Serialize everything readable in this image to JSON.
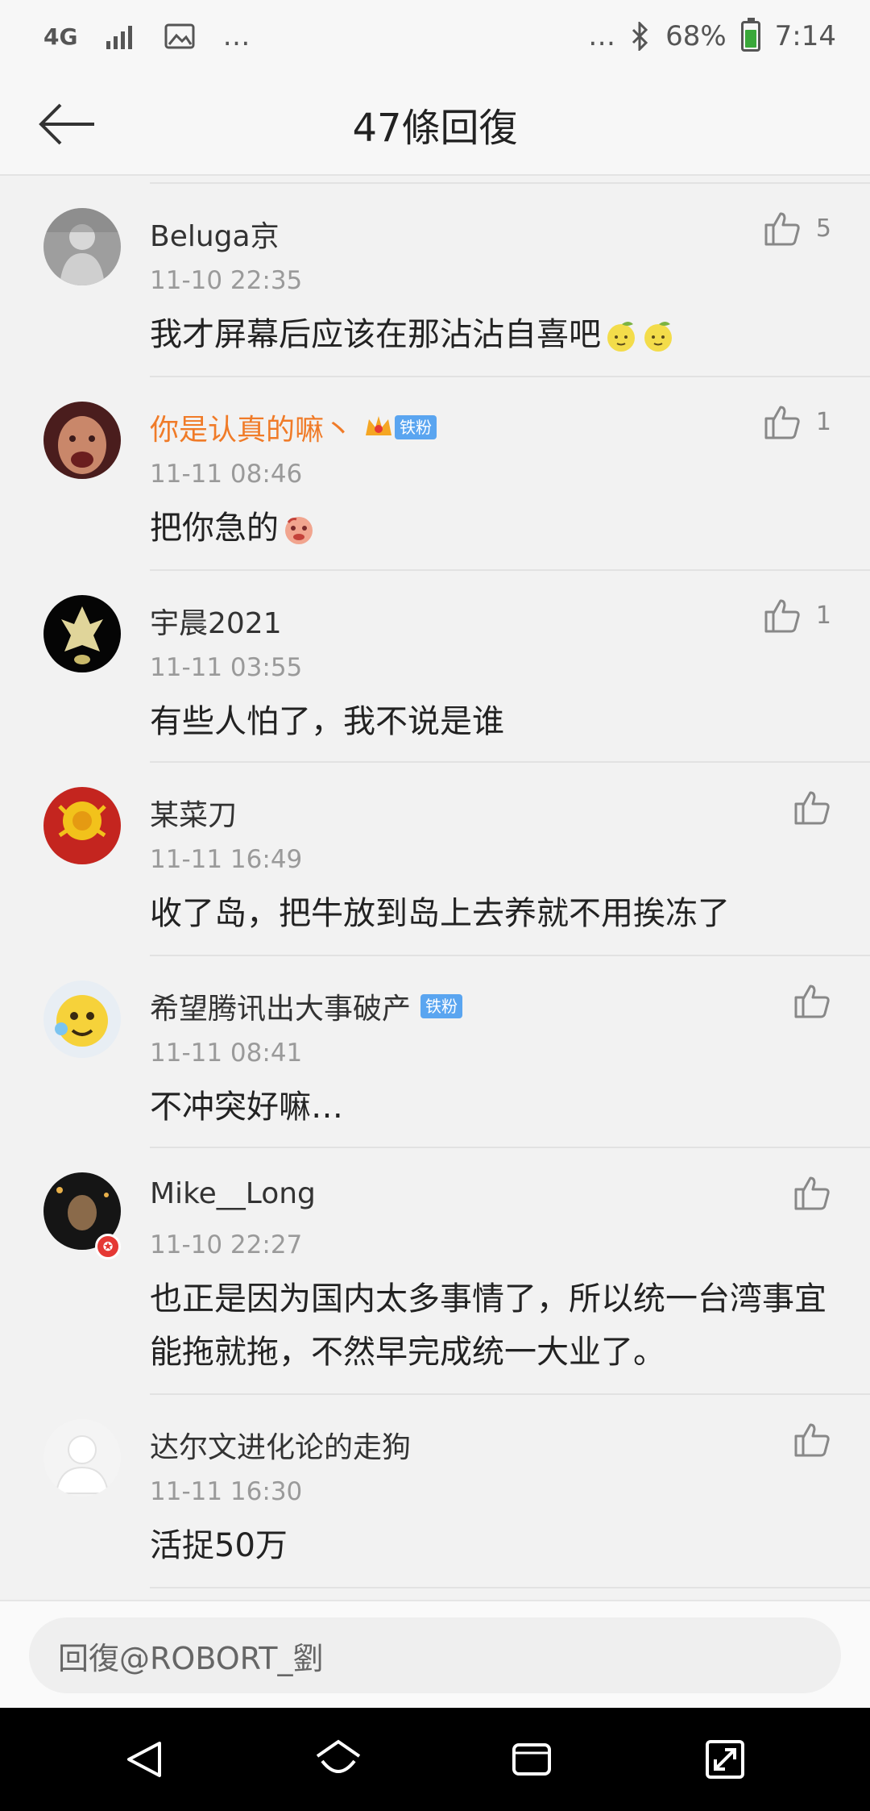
{
  "status_bar": {
    "network": "4G",
    "left_more": "…",
    "right_more": "…",
    "battery": "68%",
    "time": "7:14",
    "icons": [
      "signal-icon",
      "image-icon",
      "bluetooth-icon",
      "battery-icon"
    ]
  },
  "header": {
    "title": "47條回復",
    "back_icon": "arrow-left-icon"
  },
  "comments": [
    {
      "user": "Beluga京",
      "time": "11-10 22:35",
      "text": "我才屏幕后应该在那沾沾自喜吧",
      "likes": "5",
      "emojis": 2
    },
    {
      "user": "你是认真的嘛丶",
      "badge": "铁粉",
      "time": "11-11 08:46",
      "text": "把你急的",
      "likes": "1",
      "emojis": 1
    },
    {
      "user": "宇晨2021",
      "time": "11-11 03:55",
      "text": "有些人怕了，我不说是谁",
      "likes": "1"
    },
    {
      "user": "某菜刀",
      "time": "11-11 16:49",
      "text": "收了岛，把牛放到岛上去养就不用挨冻了",
      "likes": ""
    },
    {
      "user": "希望腾讯出大事破产",
      "badge": "铁粉",
      "time": "11-11 08:41",
      "text": "不冲突好嘛…",
      "likes": ""
    },
    {
      "user": "Mike__Long",
      "time": "11-10 22:27",
      "text": "也正是因为国内太多事情了，所以统一台湾事宜能拖就拖，不然早完成统一大业了。",
      "likes": ""
    },
    {
      "user": "达尔文进化论的走狗",
      "time": "11-11 16:30",
      "text": "活捉50万",
      "likes": ""
    }
  ],
  "reply": {
    "placeholder": "回復@ROBORT_劉"
  },
  "colors": {
    "vip_name": "#f07b28",
    "badge": "#5aa5f0",
    "battery": "#3aa83a"
  }
}
